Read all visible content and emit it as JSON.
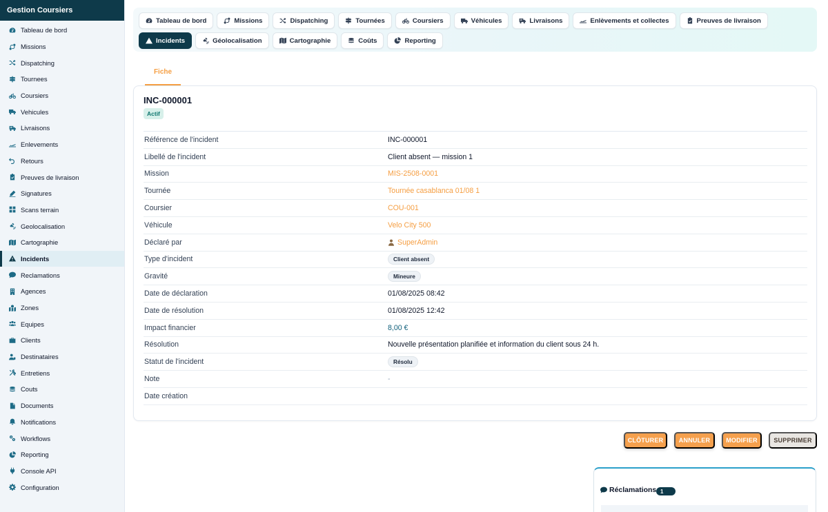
{
  "sidebar": {
    "title": "Gestion Coursiers",
    "items": [
      {
        "label": "Tableau de bord",
        "icon": "dashboard-icon"
      },
      {
        "label": "Missions",
        "icon": "route-icon"
      },
      {
        "label": "Dispatching",
        "icon": "shuffle-icon"
      },
      {
        "label": "Tournees",
        "icon": "signs-icon"
      },
      {
        "label": "Coursiers",
        "icon": "bicycle-icon"
      },
      {
        "label": "Vehicules",
        "icon": "truck-icon"
      },
      {
        "label": "Livraisons",
        "icon": "delivery-truck-icon"
      },
      {
        "label": "Enlevements",
        "icon": "plane-icon"
      },
      {
        "label": "Retours",
        "icon": "undo-icon"
      },
      {
        "label": "Preuves de livraison",
        "icon": "clipboard-check-icon"
      },
      {
        "label": "Signatures",
        "icon": "signature-icon"
      },
      {
        "label": "Scans terrain",
        "icon": "grid-icon"
      },
      {
        "label": "Geolocalisation",
        "icon": "satellite-icon"
      },
      {
        "label": "Cartographie",
        "icon": "map-icon"
      },
      {
        "label": "Incidents",
        "icon": "warning-icon",
        "active": true
      },
      {
        "label": "Reclamations",
        "icon": "comment-icon"
      },
      {
        "label": "Agences",
        "icon": "building-icon"
      },
      {
        "label": "Zones",
        "icon": "map-marked-icon"
      },
      {
        "label": "Equipes",
        "icon": "users-icon"
      },
      {
        "label": "Clients",
        "icon": "briefcase-icon"
      },
      {
        "label": "Destinataires",
        "icon": "user-tag-icon"
      },
      {
        "label": "Entretiens",
        "icon": "tools-icon"
      },
      {
        "label": "Couts",
        "icon": "coins-icon"
      },
      {
        "label": "Documents",
        "icon": "file-icon"
      },
      {
        "label": "Notifications",
        "icon": "bell-icon"
      },
      {
        "label": "Workflows",
        "icon": "cogs-icon"
      },
      {
        "label": "Reporting",
        "icon": "pie-chart-icon"
      },
      {
        "label": "Console API",
        "icon": "plug-icon"
      },
      {
        "label": "Configuration",
        "icon": "gear-icon"
      }
    ]
  },
  "top_tabs": [
    {
      "label": "Tableau de bord",
      "icon": "dashboard-icon"
    },
    {
      "label": "Missions",
      "icon": "route-icon"
    },
    {
      "label": "Dispatching",
      "icon": "shuffle-icon"
    },
    {
      "label": "Tournées",
      "icon": "signs-icon"
    },
    {
      "label": "Coursiers",
      "icon": "bicycle-icon"
    },
    {
      "label": "Véhicules",
      "icon": "truck-icon"
    },
    {
      "label": "Livraisons",
      "icon": "delivery-truck-icon"
    },
    {
      "label": "Enlèvements et collectes",
      "icon": "plane-icon"
    },
    {
      "label": "Preuves de livraison",
      "icon": "clipboard-check-icon"
    },
    {
      "label": "Incidents",
      "icon": "warning-icon",
      "active": true
    },
    {
      "label": "Géolocalisation",
      "icon": "satellite-icon"
    },
    {
      "label": "Cartographie",
      "icon": "map-icon"
    },
    {
      "label": "Coûts",
      "icon": "coins-icon"
    },
    {
      "label": "Reporting",
      "icon": "pie-chart-icon"
    }
  ],
  "sub_tab": {
    "label": "Fiche"
  },
  "record": {
    "title": "INC-000001",
    "status_badge": "Actif",
    "fields": [
      {
        "label": "Référence de l'incident",
        "value": "INC-000001",
        "kind": "text"
      },
      {
        "label": "Libellé de l'incident",
        "value": "Client absent — mission 1",
        "kind": "text"
      },
      {
        "label": "Mission",
        "value": "MIS-2508-0001",
        "kind": "link"
      },
      {
        "label": "Tournée",
        "value": "Tournée casablanca 01/08 1",
        "kind": "link"
      },
      {
        "label": "Coursier",
        "value": "COU-001",
        "kind": "link"
      },
      {
        "label": "Véhicule",
        "value": "Velo City 500",
        "kind": "link"
      },
      {
        "label": "Déclaré par",
        "value": "SuperAdmin",
        "kind": "user"
      },
      {
        "label": "Type d'incident",
        "value": "Client absent",
        "kind": "chip"
      },
      {
        "label": "Gravité",
        "value": "Mineure",
        "kind": "chip"
      },
      {
        "label": "Date de déclaration",
        "value": "01/08/2025 08:42",
        "kind": "text"
      },
      {
        "label": "Date de résolution",
        "value": "01/08/2025 12:42",
        "kind": "text"
      },
      {
        "label": "Impact financier",
        "value": "8,00 €",
        "kind": "money"
      },
      {
        "label": "Résolution",
        "value": "Nouvelle présentation planifiée et information du client sous 24 h.",
        "kind": "text"
      },
      {
        "label": "Statut de l'incident",
        "value": "Résolu",
        "kind": "chip"
      },
      {
        "label": "Note",
        "value": "-",
        "kind": "muted"
      },
      {
        "label": "Date création",
        "value": "",
        "kind": "text"
      }
    ]
  },
  "actions": {
    "close": "CLÔTURER",
    "cancel": "ANNULER",
    "edit": "MODIFIER",
    "delete": "SUPPRIMER"
  },
  "reclamations": {
    "title": "Réclamations",
    "count": "1"
  },
  "colors": {
    "primary": "#0e3a4a",
    "accent": "#f59e42",
    "link": "#f59e42",
    "money": "#0e5e7a"
  }
}
